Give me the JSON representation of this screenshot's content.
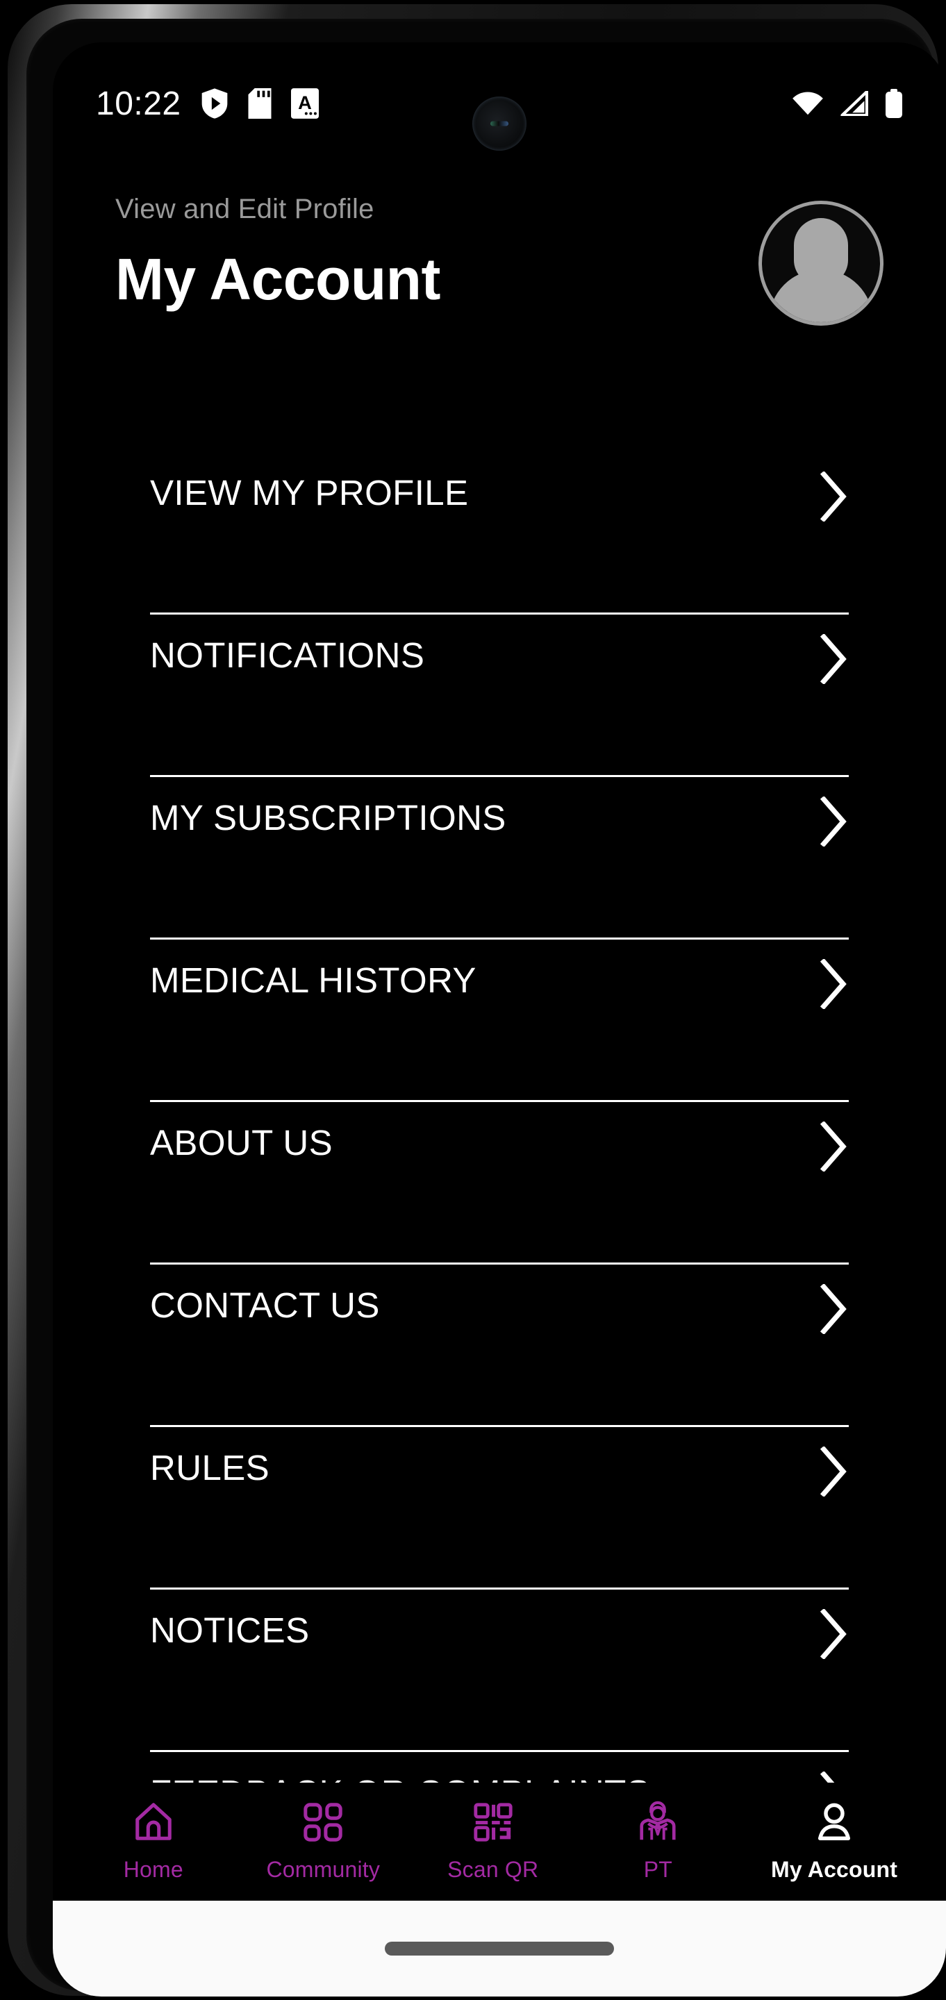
{
  "status_bar": {
    "time": "10:22",
    "left_icons": [
      "play-protect-shield-icon",
      "sd-card-icon",
      "font-size-a-icon"
    ],
    "right_icons": [
      "wifi-icon",
      "cellular-signal-icon",
      "battery-icon"
    ]
  },
  "header": {
    "breadcrumb": "View and Edit Profile",
    "title": "My Account",
    "avatar_icon": "default-user-avatar"
  },
  "menu": {
    "chevron_icon": "chevron-right-icon",
    "items": [
      {
        "label": "VIEW MY PROFILE"
      },
      {
        "label": "NOTIFICATIONS"
      },
      {
        "label": "MY SUBSCRIPTIONS"
      },
      {
        "label": "MEDICAL HISTORY"
      },
      {
        "label": "ABOUT US"
      },
      {
        "label": "CONTACT US"
      },
      {
        "label": "RULES"
      },
      {
        "label": "NOTICES"
      },
      {
        "label": "FEEDBACK OR COMPLAINTS"
      }
    ]
  },
  "bottom_nav": {
    "items": [
      {
        "label": "Home",
        "icon": "home-icon",
        "active": false
      },
      {
        "label": "Community",
        "icon": "community-icon",
        "active": false
      },
      {
        "label": "Scan QR",
        "icon": "qr-code-icon",
        "active": false
      },
      {
        "label": "PT",
        "icon": "trainer-icon",
        "active": false
      },
      {
        "label": "My Account",
        "icon": "account-icon",
        "active": true
      }
    ]
  },
  "colors": {
    "background": "#000000",
    "accent_purple": "#A32AA3",
    "active_white": "#FFFFFF",
    "breadcrumb_gray": "#9A9A9A",
    "divider": "#FFFFFF",
    "gesture_bar": "#FAFAFA"
  }
}
